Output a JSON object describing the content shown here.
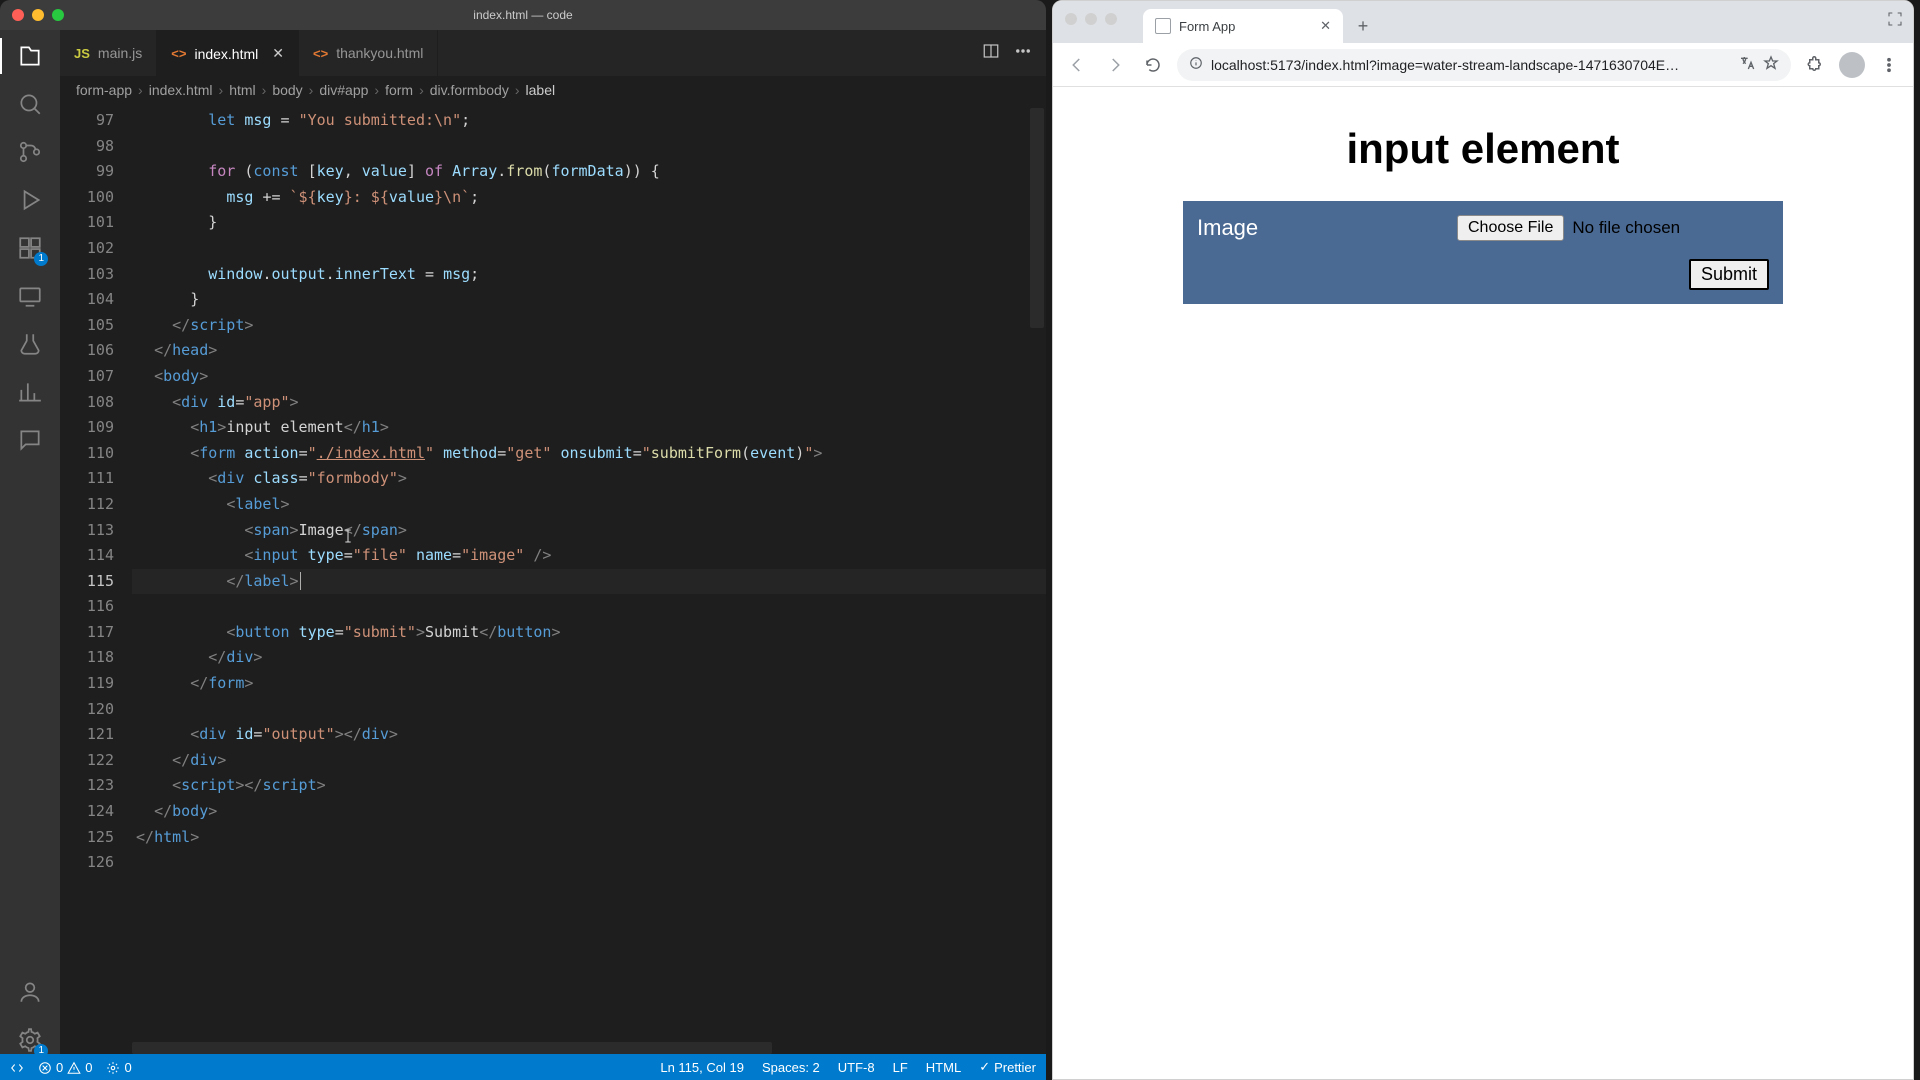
{
  "vscode": {
    "window_title": "index.html — code",
    "tabs": [
      {
        "icon": "JS",
        "label": "main.js",
        "active": false
      },
      {
        "icon": "<>",
        "label": "index.html",
        "active": true
      },
      {
        "icon": "<>",
        "label": "thankyou.html",
        "active": false
      }
    ],
    "breadcrumbs": [
      "form-app",
      "index.html",
      "html",
      "body",
      "div#app",
      "form",
      "div.formbody",
      "label"
    ],
    "line_start": 97,
    "activity_badges": {
      "extensions": "1",
      "settings": "1"
    },
    "status": {
      "errors": "0",
      "warnings": "0",
      "port": "0",
      "cursor": "Ln 115, Col 19",
      "spaces": "Spaces: 2",
      "encoding": "UTF-8",
      "eol": "LF",
      "lang": "HTML",
      "formatter": "Prettier"
    }
  },
  "browser": {
    "tab_title": "Form App",
    "url": "localhost:5173/index.html?image=water-stream-landscape-1471630704E…",
    "page": {
      "heading": "input element",
      "label": "Image",
      "choose": "Choose File",
      "nofile": "No file chosen",
      "submit": "Submit"
    }
  }
}
